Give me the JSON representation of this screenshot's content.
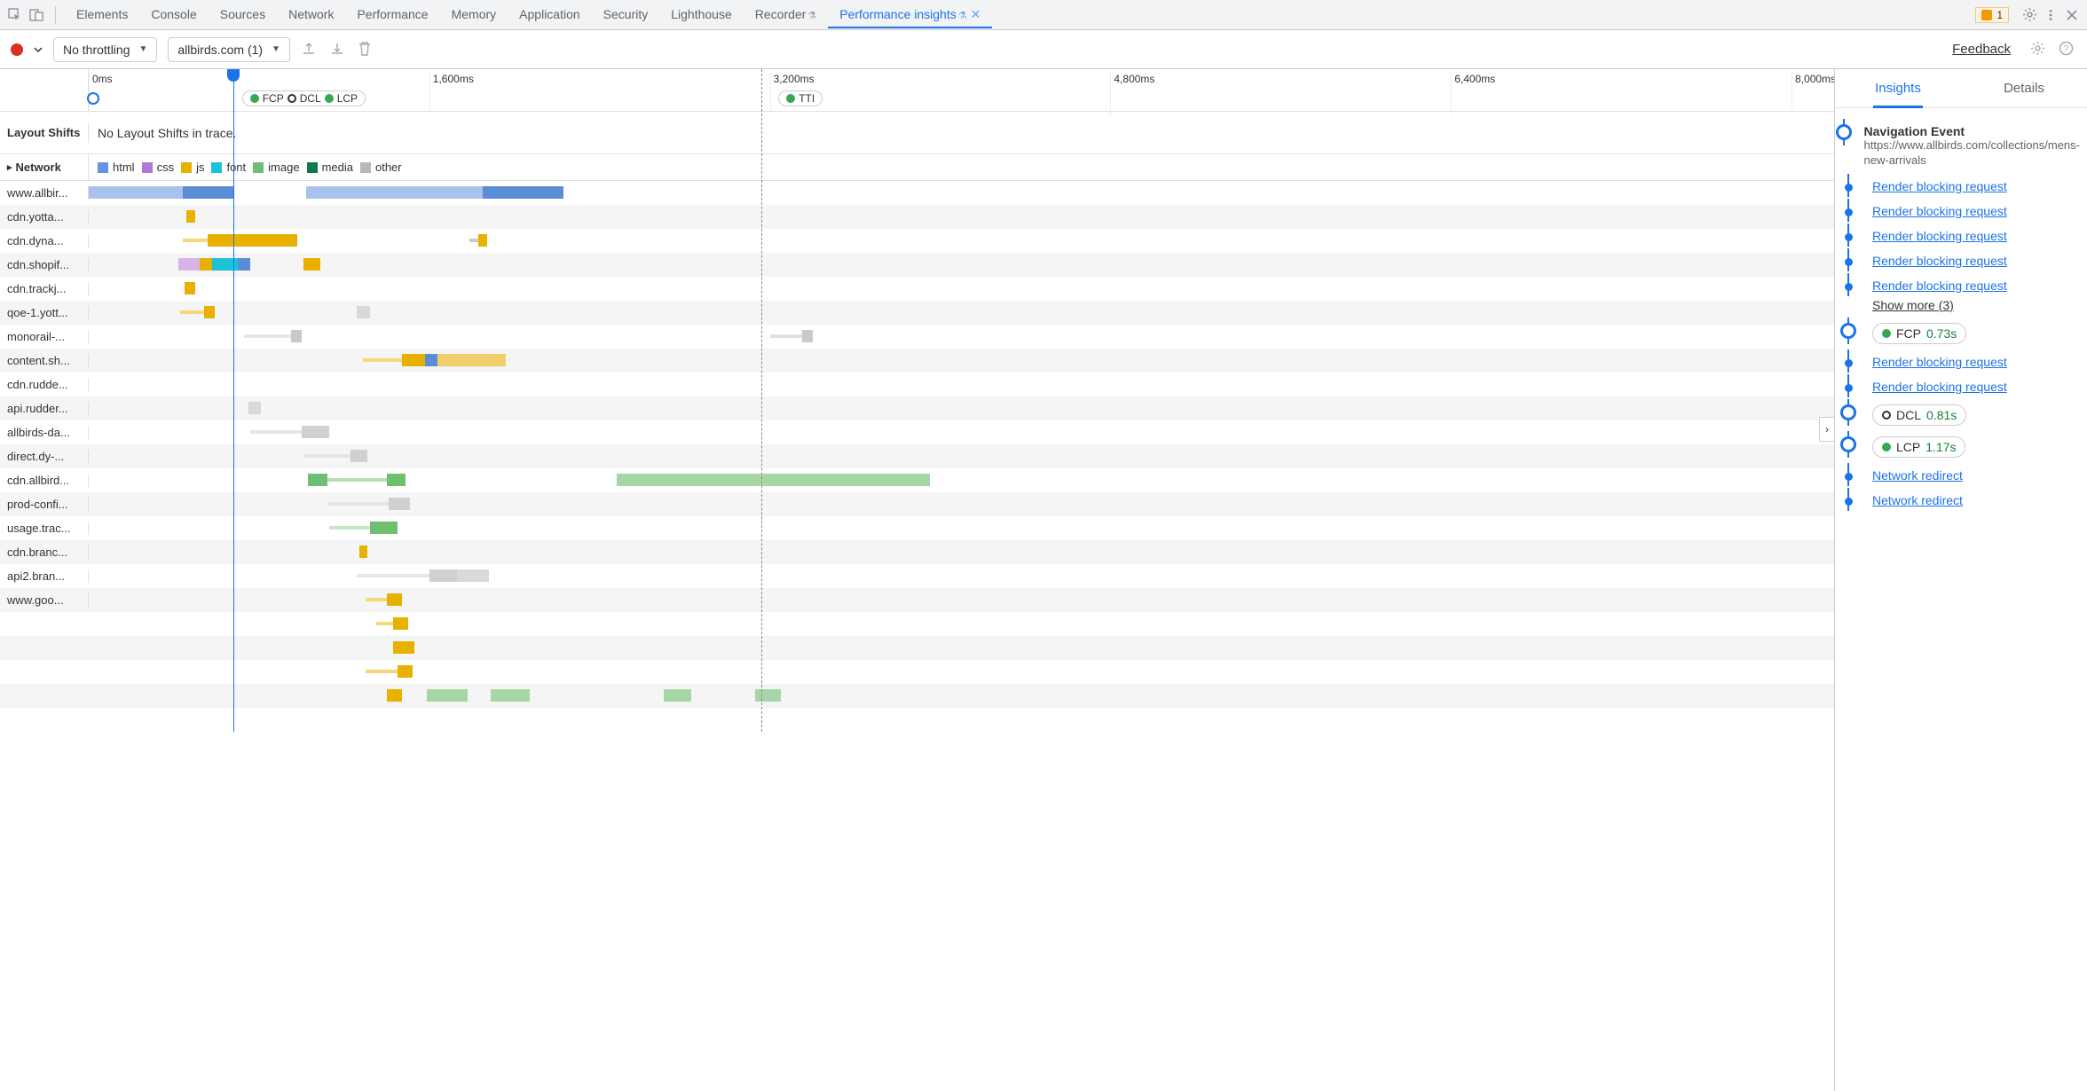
{
  "topTabs": [
    "Elements",
    "Console",
    "Sources",
    "Network",
    "Performance",
    "Memory",
    "Application",
    "Security",
    "Lighthouse",
    "Recorder",
    "Performance insights"
  ],
  "activeTopTab": 10,
  "flaskTabs": [
    9,
    10
  ],
  "closableTabs": [
    10
  ],
  "warnBadge": "1",
  "toolbar": {
    "throttling": "No throttling",
    "recording": "allbirds.com (1)",
    "feedback": "Feedback"
  },
  "ruler": {
    "max_ms": 8200,
    "ticks": [
      {
        "ms": 0,
        "label": "0ms"
      },
      {
        "ms": 1600,
        "label": "1,600ms"
      },
      {
        "ms": 3200,
        "label": "3,200ms"
      },
      {
        "ms": 4800,
        "label": "4,800ms"
      },
      {
        "ms": 6400,
        "label": "6,400ms"
      },
      {
        "ms": 8000,
        "label": "8,000ms"
      }
    ],
    "playhead_ms": 680,
    "dashed_ms": 3160,
    "pills": [
      {
        "ms": 720,
        "items": [
          {
            "type": "dot",
            "color": "#34a853",
            "label": "FCP"
          },
          {
            "type": "ring",
            "label": "DCL"
          },
          {
            "type": "dot",
            "color": "#34a853",
            "label": "LCP"
          }
        ]
      },
      {
        "ms": 3240,
        "items": [
          {
            "type": "dot",
            "color": "#34a853",
            "label": "TTI"
          }
        ]
      }
    ]
  },
  "layoutShifts": {
    "heading": "Layout Shifts",
    "message": "No Layout Shifts in trace."
  },
  "networkHeading": "Network",
  "legend": [
    {
      "c": "#6694e3",
      "t": "html"
    },
    {
      "c": "#b077d8",
      "t": "css"
    },
    {
      "c": "#e8b000",
      "t": "js"
    },
    {
      "c": "#1cc2d6",
      "t": "font"
    },
    {
      "c": "#6fbf73",
      "t": "image"
    },
    {
      "c": "#0b7a4b",
      "t": "media"
    },
    {
      "c": "#b8b8b8",
      "t": "other"
    }
  ],
  "rows": [
    {
      "label": "www.allbir...",
      "bars": [
        {
          "s": 0,
          "e": 440,
          "c": "#a8c2ec"
        },
        {
          "s": 440,
          "e": 680,
          "c": "#5b8dd6"
        },
        {
          "s": 1020,
          "e": 1850,
          "c": "#a8c2ec"
        },
        {
          "s": 1850,
          "e": 2230,
          "c": "#5b8dd6"
        }
      ]
    },
    {
      "label": "cdn.yotta...",
      "bars": [
        {
          "s": 460,
          "e": 500,
          "c": "#e8b000"
        }
      ]
    },
    {
      "label": "cdn.dyna...",
      "bars": [
        {
          "s": 440,
          "e": 560,
          "c": "#f4d87a",
          "thin": true
        },
        {
          "s": 560,
          "e": 980,
          "c": "#e8b000"
        },
        {
          "s": 1790,
          "e": 1830,
          "c": "#c9c9c9",
          "thin": true
        },
        {
          "s": 1830,
          "e": 1870,
          "c": "#e8b000"
        }
      ]
    },
    {
      "label": "cdn.shopif...",
      "bars": [
        {
          "s": 420,
          "e": 520,
          "c": "#d7b3ea"
        },
        {
          "s": 520,
          "e": 580,
          "c": "#e8b000"
        },
        {
          "s": 580,
          "e": 700,
          "c": "#1cc2d6"
        },
        {
          "s": 700,
          "e": 760,
          "c": "#5b8dd6"
        },
        {
          "s": 1010,
          "e": 1090,
          "c": "#e8b000"
        }
      ]
    },
    {
      "label": "cdn.trackj...",
      "bars": [
        {
          "s": 450,
          "e": 500,
          "c": "#e8b000"
        }
      ]
    },
    {
      "label": "qoe-1.yott...",
      "bars": [
        {
          "s": 430,
          "e": 540,
          "c": "#f4d87a",
          "thin": true
        },
        {
          "s": 540,
          "e": 590,
          "c": "#e8b000"
        },
        {
          "s": 1260,
          "e": 1320,
          "c": "#d9d9d9"
        }
      ]
    },
    {
      "label": "monorail-...",
      "bars": [
        {
          "s": 730,
          "e": 950,
          "c": "#e6e6e6",
          "thin": true
        },
        {
          "s": 950,
          "e": 1000,
          "c": "#c9c9c9"
        },
        {
          "s": 3200,
          "e": 3350,
          "c": "#e0e0e0",
          "thin": true
        },
        {
          "s": 3350,
          "e": 3400,
          "c": "#c9c9c9"
        }
      ]
    },
    {
      "label": "content.sh...",
      "bars": [
        {
          "s": 1290,
          "e": 1470,
          "c": "#f4d87a",
          "thin": true
        },
        {
          "s": 1470,
          "e": 1580,
          "c": "#e8b000"
        },
        {
          "s": 1580,
          "e": 1640,
          "c": "#5b8dd6"
        },
        {
          "s": 1640,
          "e": 1960,
          "c": "#f2ce6a"
        }
      ]
    },
    {
      "label": "cdn.rudde...",
      "bars": []
    },
    {
      "label": "api.rudder...",
      "bars": [
        {
          "s": 750,
          "e": 810,
          "c": "#d9d9d9"
        }
      ]
    },
    {
      "label": "allbirds-da...",
      "bars": [
        {
          "s": 760,
          "e": 1000,
          "c": "#e6e6e6",
          "thin": true
        },
        {
          "s": 1000,
          "e": 1130,
          "c": "#d0d0d0"
        }
      ]
    },
    {
      "label": "direct.dy-...",
      "bars": [
        {
          "s": 1010,
          "e": 1230,
          "c": "#e6e6e6",
          "thin": true
        },
        {
          "s": 1230,
          "e": 1310,
          "c": "#d0d0d0"
        }
      ]
    },
    {
      "label": "cdn.allbird...",
      "bars": [
        {
          "s": 1030,
          "e": 1120,
          "c": "#6fbf73"
        },
        {
          "s": 1120,
          "e": 1400,
          "c": "#b7dcb7",
          "thin": true
        },
        {
          "s": 1400,
          "e": 1490,
          "c": "#6fbf73"
        },
        {
          "s": 2480,
          "e": 3470,
          "c": "#a6d6a6"
        },
        {
          "s": 3470,
          "e": 3950,
          "c": "#a6d6a6"
        }
      ]
    },
    {
      "label": "prod-confi...",
      "bars": [
        {
          "s": 1120,
          "e": 1410,
          "c": "#e6e6e6",
          "thin": true
        },
        {
          "s": 1410,
          "e": 1510,
          "c": "#d0d0d0"
        }
      ]
    },
    {
      "label": "usage.trac...",
      "bars": [
        {
          "s": 1130,
          "e": 1320,
          "c": "#c8e6c8",
          "thin": true
        },
        {
          "s": 1320,
          "e": 1450,
          "c": "#6fbf73"
        }
      ]
    },
    {
      "label": "cdn.branc...",
      "bars": [
        {
          "s": 1270,
          "e": 1310,
          "c": "#e8b000"
        }
      ]
    },
    {
      "label": "api2.bran...",
      "bars": [
        {
          "s": 1260,
          "e": 1600,
          "c": "#e6e6e6",
          "thin": true
        },
        {
          "s": 1600,
          "e": 1730,
          "c": "#d0d0d0"
        },
        {
          "s": 1730,
          "e": 1880,
          "c": "#d9d9d9"
        }
      ]
    },
    {
      "label": "www.goo...",
      "bars": [
        {
          "s": 1300,
          "e": 1400,
          "c": "#f4d87a",
          "thin": true
        },
        {
          "s": 1400,
          "e": 1470,
          "c": "#e8b000"
        }
      ]
    },
    {
      "label": "",
      "bars": [
        {
          "s": 1350,
          "e": 1430,
          "c": "#f4d87a",
          "thin": true
        },
        {
          "s": 1430,
          "e": 1500,
          "c": "#e8b000"
        }
      ]
    },
    {
      "label": "",
      "bars": [
        {
          "s": 1430,
          "e": 1530,
          "c": "#e8b000"
        }
      ]
    },
    {
      "label": "",
      "bars": [
        {
          "s": 1300,
          "e": 1450,
          "c": "#f4d87a",
          "thin": true
        },
        {
          "s": 1450,
          "e": 1520,
          "c": "#e8b000"
        }
      ]
    },
    {
      "label": "",
      "bars": [
        {
          "s": 1400,
          "e": 1470,
          "c": "#e8b000"
        },
        {
          "s": 1590,
          "e": 1780,
          "c": "#a6d6a6"
        },
        {
          "s": 1890,
          "e": 2070,
          "c": "#a6d6a6"
        },
        {
          "s": 2700,
          "e": 2830,
          "c": "#a6d6a6"
        },
        {
          "s": 3130,
          "e": 3250,
          "c": "#a6d6a6"
        }
      ]
    }
  ],
  "rightTabs": [
    "Insights",
    "Details"
  ],
  "activeRightTab": 0,
  "insights": [
    {
      "k": "big",
      "title": "Navigation Event",
      "sub": "https://www.allbirds.com/collections/mens-new-arrivals"
    },
    {
      "k": "sm",
      "link": "Render blocking request"
    },
    {
      "k": "sm",
      "link": "Render blocking request"
    },
    {
      "k": "sm",
      "link": "Render blocking request"
    },
    {
      "k": "sm",
      "link": "Render blocking request"
    },
    {
      "k": "sm",
      "link": "Render blocking request",
      "showMore": "Show more (3)"
    },
    {
      "k": "big",
      "pill": {
        "icon": "dot",
        "color": "#34a853",
        "label": "FCP",
        "time": "0.73s"
      }
    },
    {
      "k": "sm",
      "link": "Render blocking request"
    },
    {
      "k": "sm",
      "link": "Render blocking request"
    },
    {
      "k": "big",
      "pill": {
        "icon": "ring",
        "label": "DCL",
        "time": "0.81s"
      }
    },
    {
      "k": "big",
      "pill": {
        "icon": "dot",
        "color": "#34a853",
        "label": "LCP",
        "time": "1.17s"
      }
    },
    {
      "k": "sm",
      "link": "Network redirect"
    },
    {
      "k": "sm",
      "link": "Network redirect"
    }
  ]
}
